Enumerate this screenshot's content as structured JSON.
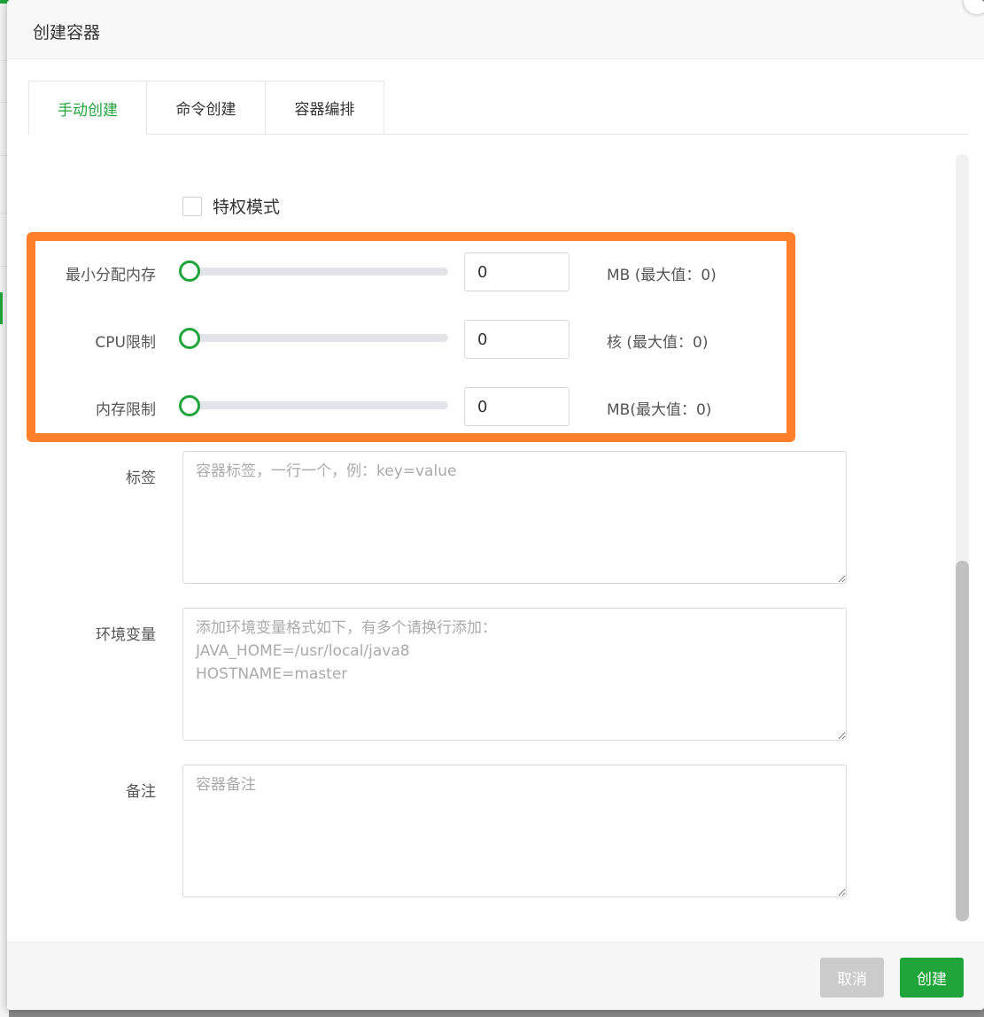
{
  "dialog": {
    "title": "创建容器"
  },
  "tabs": [
    {
      "label": "手动创建",
      "active": true
    },
    {
      "label": "命令创建",
      "active": false
    },
    {
      "label": "容器编排",
      "active": false
    }
  ],
  "privileged": {
    "label": "特权模式",
    "checked": false
  },
  "resources": {
    "min_memory": {
      "label": "最小分配内存",
      "value": "0",
      "unit": "MB (最大值：0)"
    },
    "cpu_limit": {
      "label": "CPU限制",
      "value": "0",
      "unit": "核 (最大值：0)"
    },
    "memory_limit": {
      "label": "内存限制",
      "value": "0",
      "unit": "MB(最大值：0)"
    }
  },
  "labels_field": {
    "label": "标签",
    "placeholder": "容器标签，一行一个，例：key=value"
  },
  "env_field": {
    "label": "环境变量",
    "placeholder": "添加环境变量格式如下，有多个请换行添加：\nJAVA_HOME=/usr/local/java8\nHOSTNAME=master"
  },
  "remark_field": {
    "label": "备注",
    "placeholder": "容器备注"
  },
  "footer": {
    "cancel_label": "取消",
    "create_label": "创建"
  },
  "colors": {
    "accent": "#20a53a",
    "highlight": "#ff7f2a",
    "cancel": "#cbcbcb"
  }
}
